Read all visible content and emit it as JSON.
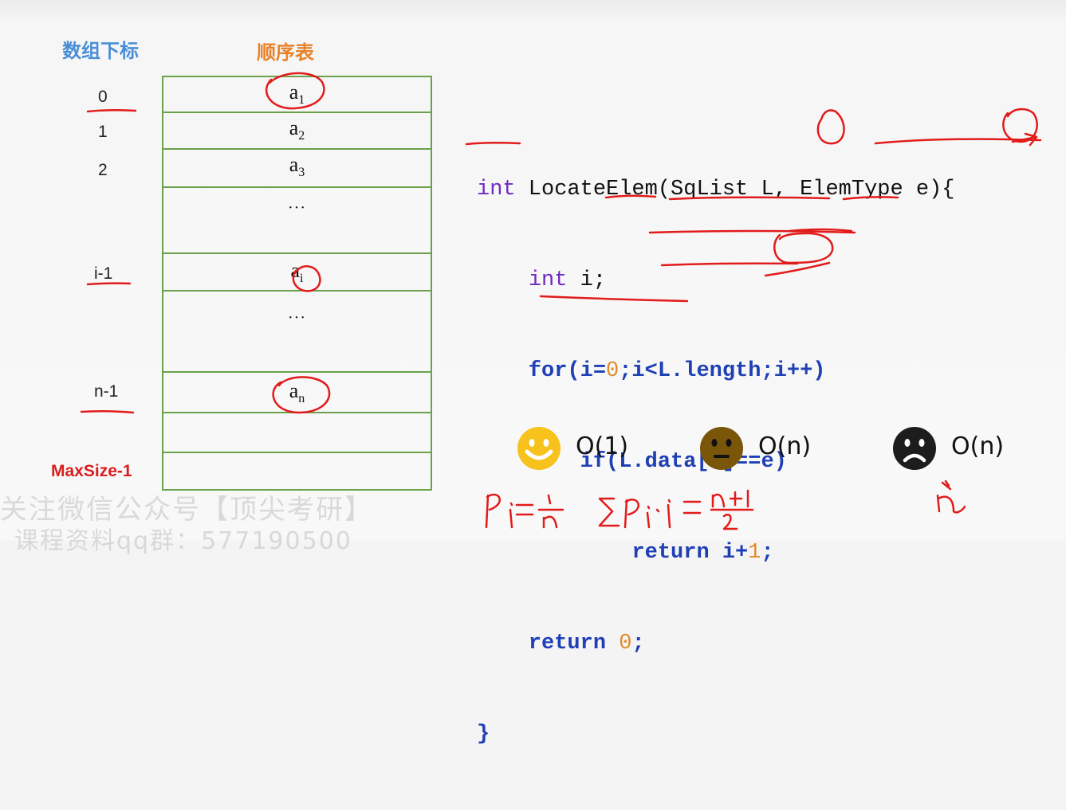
{
  "headers": {
    "index": "数组下标",
    "list": "顺序表"
  },
  "indices": [
    "0",
    "1",
    "2",
    "i-1",
    "n-1"
  ],
  "max_label": "MaxSize-1",
  "cells": {
    "a": "a",
    "s1": "1",
    "s2": "2",
    "s3": "3",
    "si": "i",
    "sn": "n",
    "dots": "···"
  },
  "code": {
    "l1_type": "int",
    "l1_rest": " LocateElem(SqList L, ElemType e){",
    "l2_type": "int",
    "l2_rest": " i;",
    "l3_for": "for",
    "l3_a": "(i=",
    "l3_zero": "0",
    "l3_b": ";i<L.length;i++)",
    "l4_if": "if",
    "l4_rest": "(L.data[i]==e)",
    "l5_ret": "return",
    "l5_a": " i+",
    "l5_one": "1",
    "l5_b": ";",
    "l6_ret": "return",
    "l6_sp": " ",
    "l6_zero": "0",
    "l6_b": ";",
    "l7": "}"
  },
  "complexity": {
    "best": "O(1)",
    "avg": "O(n)",
    "worst": "O(n)"
  },
  "icons": {
    "best": "happy-face-icon",
    "avg": "neutral-face-icon",
    "worst": "sad-face-icon"
  },
  "colors": {
    "happy": "#f7c21b",
    "neutral": "#7a5608",
    "sad": "#1d1d1d",
    "ink": "#e21b1b",
    "grid": "#6aa14a"
  },
  "watermark": {
    "line1": "关注微信公众号【顶尖考研】",
    "line2": "课程资料qq群：577190500"
  }
}
